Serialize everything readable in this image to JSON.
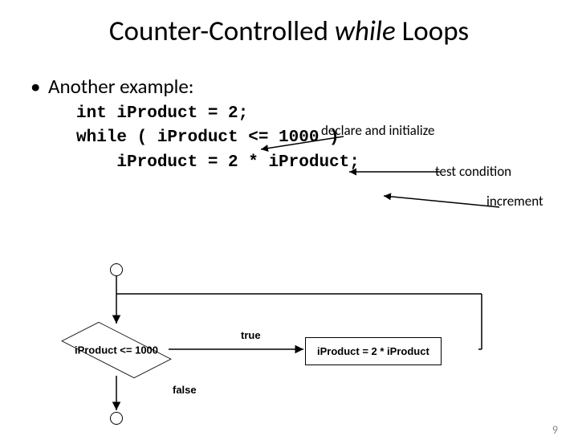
{
  "title": {
    "pre": "Counter-Controlled ",
    "italic": "while",
    "post": " Loops"
  },
  "bullet": "Another example:",
  "code": {
    "line1": "int iProduct = 2;",
    "line2": "while ( iProduct <= 1000 )",
    "line3": "    iProduct = 2 * iProduct;"
  },
  "annotations": {
    "declare": "declare and initialize",
    "testcond": "test condition",
    "increment": "increment"
  },
  "flowchart": {
    "condition": "iProduct <= 1000",
    "true_label": "true",
    "false_label": "false",
    "action": "iProduct = 2 * iProduct"
  },
  "page_number": "9"
}
